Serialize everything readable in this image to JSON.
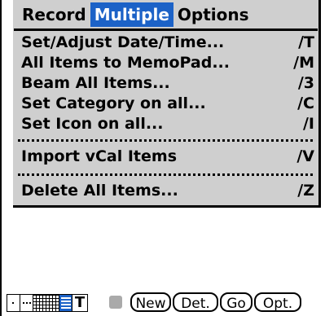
{
  "menubar": {
    "menus": [
      "Record",
      "Multiple",
      "Options"
    ],
    "active_index": 1
  },
  "menu": {
    "items": [
      {
        "label": "Set/Adjust Date/Time...",
        "shortcut": "∕T"
      },
      {
        "label": "All Items to MemoPad...",
        "shortcut": "∕M"
      },
      {
        "label": "Beam All Items...",
        "shortcut": "∕3"
      },
      {
        "label": "Set Category on all...",
        "shortcut": "∕C"
      },
      {
        "label": "Set Icon on all...",
        "shortcut": "∕I"
      },
      {
        "label": "Import vCal Items",
        "shortcut": "∕V"
      },
      {
        "label": "Delete All Items...",
        "shortcut": "∕Z"
      }
    ]
  },
  "toolbar": {
    "view_text_label": "T",
    "new_label": "New",
    "details_label": "Det.",
    "go_label": "Go",
    "options_label": "Opt."
  },
  "colors": {
    "accent": "#1c62c7",
    "menu_bg": "#cfcfcf"
  }
}
